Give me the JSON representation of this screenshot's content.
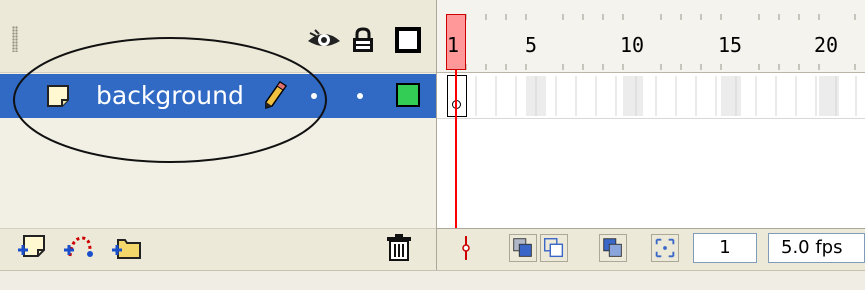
{
  "header": {
    "eye_icon": "eye-icon",
    "lock_icon": "lock-icon",
    "outline_icon": "outline-icon"
  },
  "layers": [
    {
      "name": "background",
      "selected": true,
      "outline_color": "#33cc55"
    }
  ],
  "ruler": {
    "playhead": "1",
    "labels": [
      "5",
      "10",
      "15",
      "20"
    ]
  },
  "footer": {
    "current_frame": "1",
    "frame_rate": "5.0 fps"
  },
  "colors": {
    "selection": "#316ac5",
    "playhead": "#ff0000",
    "playhead_fill": "#ff9999"
  }
}
